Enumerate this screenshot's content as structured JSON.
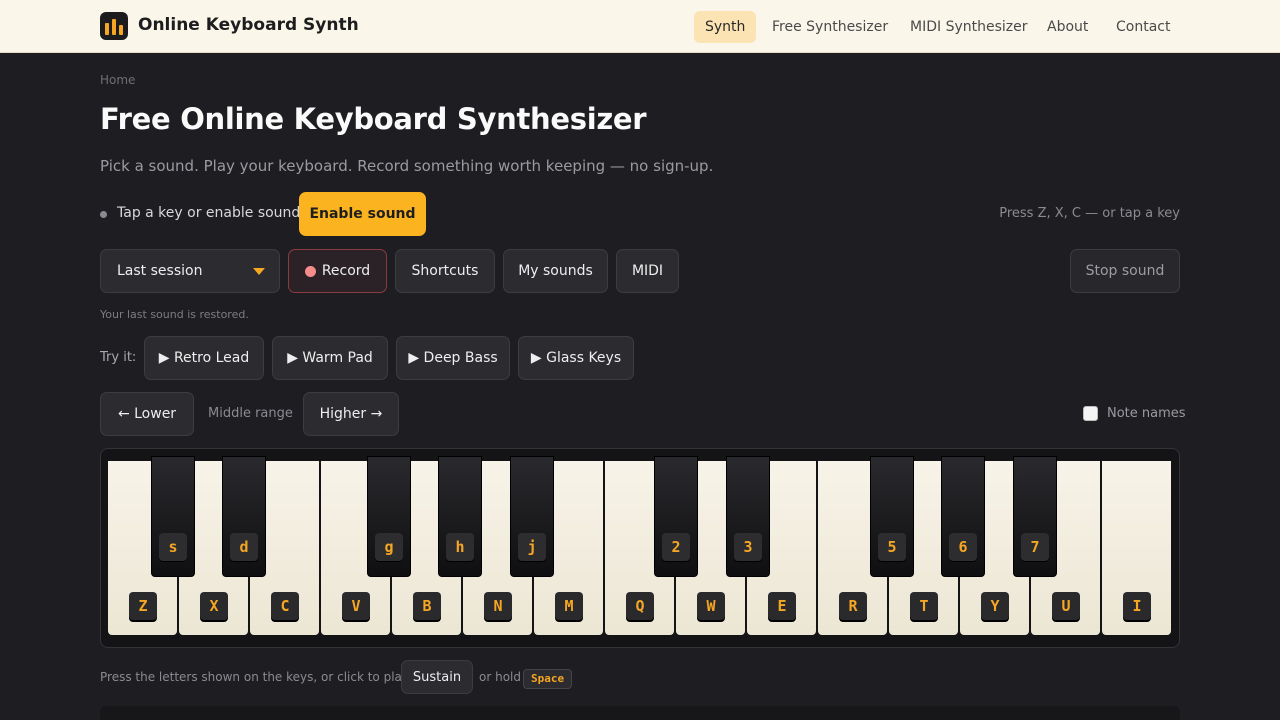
{
  "header": {
    "brand": "Online Keyboard Synth",
    "nav": [
      {
        "label": "Synth",
        "active": true
      },
      {
        "label": "Free Synthesizer",
        "active": false
      },
      {
        "label": "MIDI Synthesizer",
        "active": false
      },
      {
        "label": "About",
        "active": false
      },
      {
        "label": "Contact",
        "active": false
      }
    ]
  },
  "breadcrumb": "Home",
  "title": "Free Online Keyboard Synthesizer",
  "subtitle": "Pick a sound. Play your keyboard. Record something worth keeping — no sign-up.",
  "status": {
    "text": "Tap a key or enable sound",
    "enable_label": "Enable sound",
    "hint": "Press Z, X, C — or tap a key"
  },
  "toolbar": {
    "preset_selected": "Last session",
    "record_label": "Record",
    "shortcuts_label": "Shortcuts",
    "my_sounds_label": "My sounds",
    "midi_label": "MIDI",
    "stop_label": "Stop sound"
  },
  "restore_note": "Your last sound is restored.",
  "presets": {
    "label": "Try it:",
    "items": [
      "▶ Retro Lead",
      "▶ Warm Pad",
      "▶ Deep Bass",
      "▶ Glass Keys"
    ]
  },
  "octave": {
    "lower_label": "← Lower",
    "range_label": "Middle range",
    "higher_label": "Higher →"
  },
  "note_names": {
    "label": "Note names",
    "checked": false
  },
  "keyboard": {
    "white_keys": [
      "Z",
      "X",
      "C",
      "V",
      "B",
      "N",
      "M",
      "Q",
      "W",
      "E",
      "R",
      "T",
      "Y",
      "U",
      "I"
    ],
    "black_keys": [
      "s",
      "d",
      "g",
      "h",
      "j",
      "2",
      "3",
      "5",
      "6",
      "7"
    ]
  },
  "footer": {
    "press_text": "Press the letters shown on the keys, or click to play.",
    "sustain_label": "Sustain",
    "hold_text": "or hold",
    "space_key": "Space"
  },
  "colors": {
    "accent": "#fbb320",
    "background": "#1e1e22",
    "header_bg": "#faf6ea"
  }
}
